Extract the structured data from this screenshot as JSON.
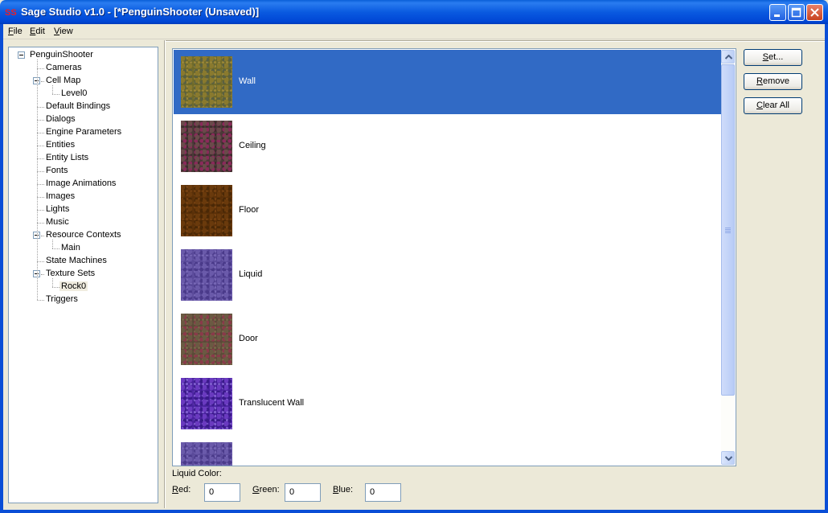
{
  "window": {
    "title": "Sage Studio v1.0 - [*PenguinShooter (Unsaved)]",
    "icon": "app-icon",
    "controls": [
      "minimize-icon",
      "maximize-icon",
      "close-icon"
    ]
  },
  "menu": [
    {
      "accel": "F",
      "rest": "ile"
    },
    {
      "accel": "E",
      "rest": "dit"
    },
    {
      "accel": "V",
      "rest": "iew"
    }
  ],
  "tree": {
    "root": "PenguinShooter",
    "items": [
      {
        "label": "Cameras"
      },
      {
        "label": "Cell Map",
        "children": [
          "Level0"
        ]
      },
      {
        "label": "Default Bindings"
      },
      {
        "label": "Dialogs"
      },
      {
        "label": "Engine Parameters"
      },
      {
        "label": "Entities"
      },
      {
        "label": "Entity Lists"
      },
      {
        "label": "Fonts"
      },
      {
        "label": "Image Animations"
      },
      {
        "label": "Images"
      },
      {
        "label": "Lights"
      },
      {
        "label": "Music"
      },
      {
        "label": "Resource Contexts",
        "children": [
          "Main"
        ]
      },
      {
        "label": "State Machines"
      },
      {
        "label": "Texture Sets",
        "children": [
          "Rock0"
        ]
      },
      {
        "label": "Triggers"
      }
    ],
    "selected": "Rock0"
  },
  "textures": [
    {
      "label": "Wall",
      "selected": true,
      "colors": [
        "#6e6a2a",
        "#8a7a2e",
        "#5a6040",
        "#a08a3a"
      ]
    },
    {
      "label": "Ceiling",
      "selected": false,
      "colors": [
        "#4a3a38",
        "#6a4a4a",
        "#8a2a5a",
        "#3a2a2a"
      ]
    },
    {
      "label": "Floor",
      "selected": false,
      "colors": [
        "#5a3008",
        "#6a3a0c",
        "#4a2806",
        "#7a4412"
      ]
    },
    {
      "label": "Liquid",
      "selected": false,
      "colors": [
        "#5a4a9a",
        "#6a5aaa",
        "#4a3a8a",
        "#7a6ab8"
      ]
    },
    {
      "label": "Door",
      "selected": false,
      "colors": [
        "#5a4a38",
        "#6a5a42",
        "#8a3a4a",
        "#7a6a4a"
      ]
    },
    {
      "label": "Translucent Wall",
      "selected": false,
      "colors": [
        "#4a22a0",
        "#6a3ac0",
        "#3a1a8a",
        "#8a6ad8"
      ]
    },
    {
      "label": "",
      "selected": false,
      "colors": [
        "#5a4a9a",
        "#6a5aaa",
        "#4a3a8a",
        "#7a6ab8"
      ]
    }
  ],
  "buttons": [
    {
      "accel": "S",
      "rest": "et..."
    },
    {
      "accel": "R",
      "rest": "emove"
    },
    {
      "accel": "C",
      "rest": "lear All"
    }
  ],
  "liquid_color": {
    "title": "Liquid Color:",
    "red": {
      "accel": "R",
      "rest": "ed:",
      "value": "0"
    },
    "green": {
      "accel": "G",
      "rest": "reen:",
      "value": "0"
    },
    "blue": {
      "accel": "B",
      "rest": "lue:",
      "value": "0"
    }
  }
}
